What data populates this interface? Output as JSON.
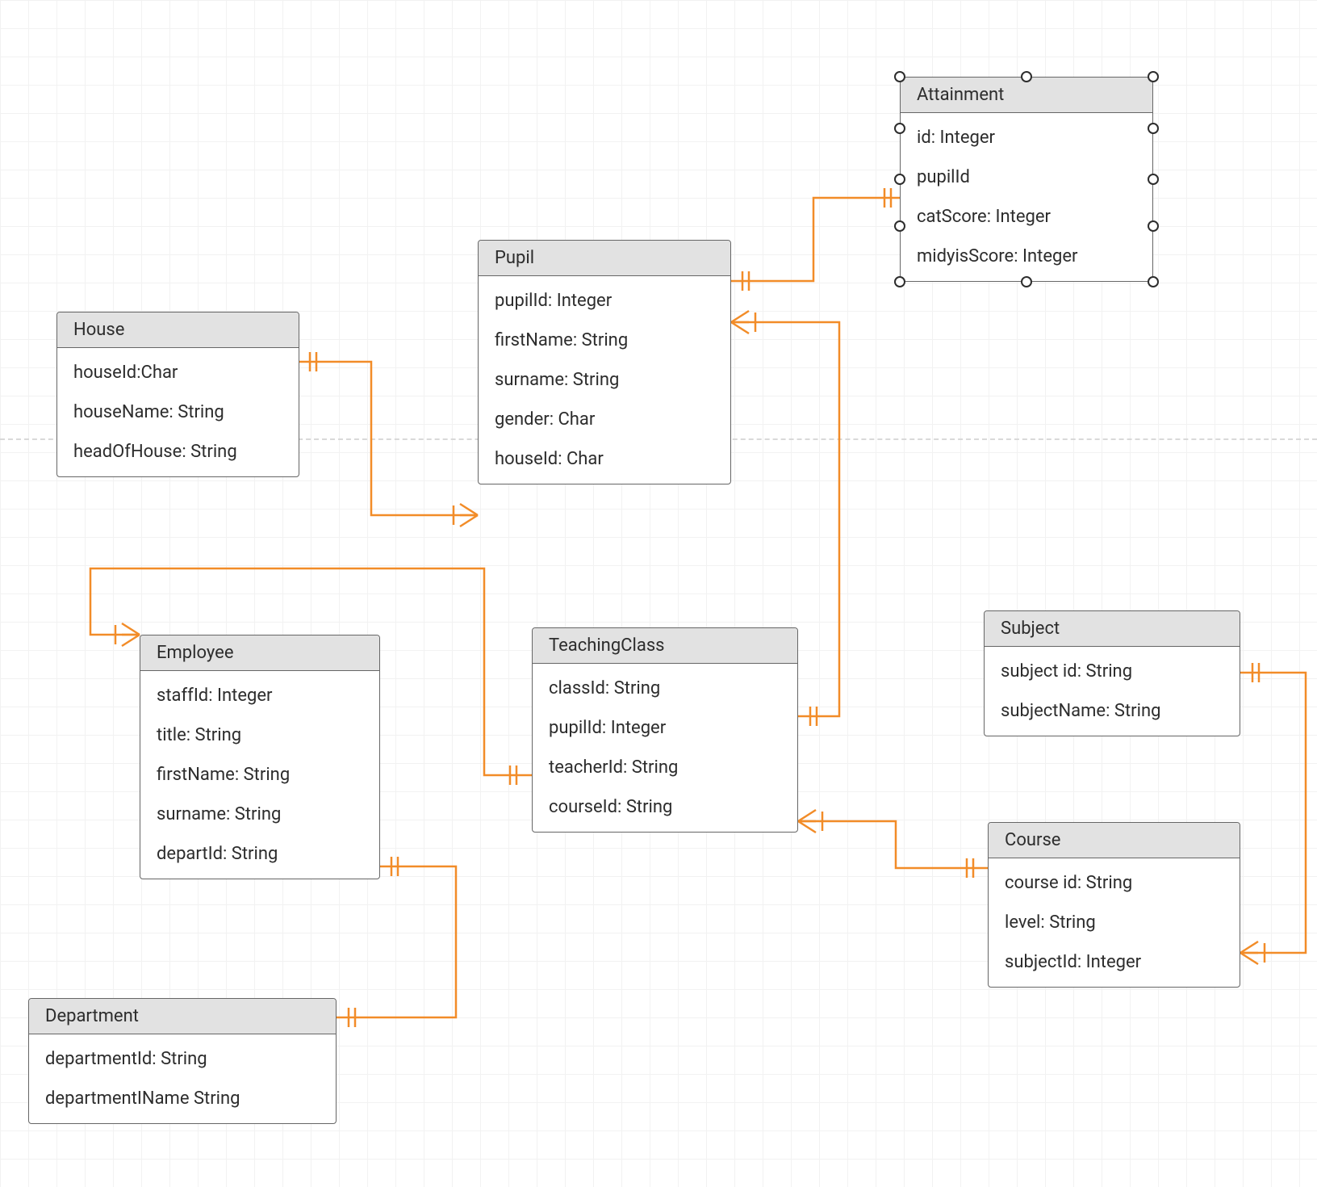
{
  "entities": {
    "house": {
      "title": "House",
      "attrs": [
        "houseId:Char",
        "houseName: String",
        "headOfHouse: String"
      ]
    },
    "pupil": {
      "title": "Pupil",
      "attrs": [
        "pupilId: Integer",
        "firstName: String",
        "surname: String",
        "gender: Char",
        "houseId: Char"
      ]
    },
    "attainment": {
      "title": "Attainment",
      "attrs": [
        "id: Integer",
        "pupilId",
        "catScore: Integer",
        "midyisScore: Integer"
      ]
    },
    "employee": {
      "title": "Employee",
      "attrs": [
        "staffId: Integer",
        "title: String",
        "firstName: String",
        "surname: String",
        "departId: String"
      ]
    },
    "teachingclass": {
      "title": "TeachingClass",
      "attrs": [
        "classId: String",
        "pupilId: Integer",
        "teacherId: String",
        "courseId: String"
      ]
    },
    "subject": {
      "title": "Subject",
      "attrs": [
        "subject id: String",
        "subjectName: String"
      ]
    },
    "course": {
      "title": "Course",
      "attrs": [
        "course id: String",
        "level: String",
        "subjectId: Integer"
      ]
    },
    "department": {
      "title": "Department",
      "attrs": [
        "departmentId: String",
        "departmentIName String"
      ]
    }
  },
  "colors": {
    "connector": "#f28c28",
    "entityHeader": "#e2e2e2",
    "entityBorder": "#666666"
  },
  "relationships": [
    {
      "from": "House",
      "end_from": "one",
      "to": "Pupil",
      "end_to": "many"
    },
    {
      "from": "Pupil",
      "end_from": "one",
      "to": "Attainment",
      "end_to": "one"
    },
    {
      "from": "Pupil",
      "end_from": "one",
      "to": "TeachingClass",
      "end_to": "many",
      "note": "crow at pupil side in image"
    },
    {
      "from": "Employee",
      "end_from": "many",
      "to": "TeachingClass",
      "end_to": "one"
    },
    {
      "from": "Department",
      "end_from": "one",
      "to": "Employee",
      "end_to": "one"
    },
    {
      "from": "TeachingClass",
      "end_from": "many",
      "to": "Course",
      "end_to": "one"
    },
    {
      "from": "Subject",
      "end_from": "one",
      "to": "Course",
      "end_to": "many"
    }
  ]
}
